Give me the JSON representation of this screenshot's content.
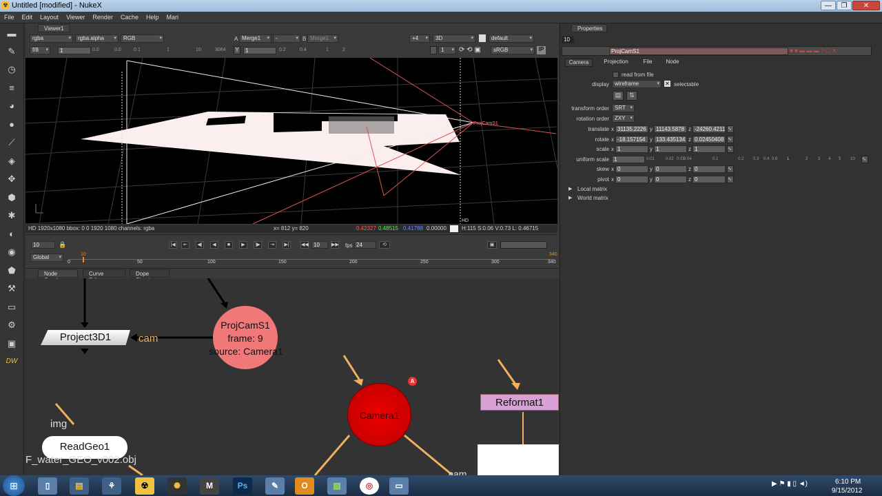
{
  "window": {
    "title": "Untitled [modified] - NukeX",
    "minimize": "—",
    "maximize": "❐",
    "close": "✕"
  },
  "menu": [
    "File",
    "Edit",
    "Layout",
    "Viewer",
    "Render",
    "Cache",
    "Help",
    "Mari"
  ],
  "viewer": {
    "tab": "Viewer1",
    "channels": "rgba",
    "alpha": "rgba.alpha",
    "display_channels": "RGB",
    "a_label": "A",
    "a_input": "Merge1",
    "a_op": "-",
    "b_label": "B",
    "b_input": "Merge1",
    "zoom": "+4",
    "view_mode": "3D",
    "lut": "default",
    "fstop": "f/8",
    "gain": "1",
    "gain_ticks": [
      "0.0",
      "0.0",
      "0.1",
      "1",
      "10",
      "3064"
    ],
    "gamma_label": "Y",
    "gamma": "1",
    "gamma_ticks": [
      "0.2",
      "0.4",
      "1",
      "2"
    ],
    "frame_field": "1",
    "proxy": "1",
    "colorspace": "sRGB",
    "ip": "IP",
    "cam_label": "ProjCamS1",
    "hd_label": "HD",
    "status": {
      "format": "HD 1920x1080 bbox: 0 0 1920 1080 channels: rgba",
      "coords": "x= 812 y= 820",
      "r": "0.42327",
      "g": "0.48515",
      "b": "0.41788",
      "a": "0.00000",
      "hsv": "H:115 S:0.06 V:0.73  L: 0.46715"
    }
  },
  "playback": {
    "frame": "10",
    "step": "10",
    "fps_label": "fps",
    "fps": "24",
    "range_mode": "Global"
  },
  "timeline": {
    "ticks": [
      "0",
      "50",
      "100",
      "150",
      "200",
      "250",
      "300",
      "340"
    ],
    "current": "10",
    "end": "340"
  },
  "tabs": {
    "node_graph": "Node Graph",
    "curve_editor": "Curve Editor",
    "dope_sheet": "Dope Sheet"
  },
  "nodes": {
    "project3d": "Project3D1",
    "cam_label": "cam",
    "projcam_name": "ProjCamS1",
    "projcam_frame": "frame: 9",
    "projcam_source": "source: Camera1",
    "camera": "Camera1",
    "reformat": "Reformat1",
    "readgeo": "ReadGeo1",
    "readgeo_file": "F_water_GEO_v002.obj",
    "img_label": "img",
    "cam_label2": "cam",
    "badge": "A"
  },
  "properties": {
    "tab": "Properties",
    "count": "10",
    "node_name": "ProjCamS1",
    "tabs": [
      "Camera",
      "Projection",
      "File",
      "Node"
    ],
    "read_from_file": "read from file",
    "display_label": "display",
    "display_value": "wireframe",
    "selectable": "selectable",
    "transform_order_label": "transform order",
    "transform_order": "SRT",
    "rotation_order_label": "rotation order",
    "rotation_order": "ZXY",
    "rows": [
      {
        "label": "translate",
        "x": "31135.2226",
        "y": "11143.5878",
        "z": "-24260.4211"
      },
      {
        "label": "rotate",
        "x": "-18.157154",
        "y": "133.435134",
        "z": "0.02450408"
      },
      {
        "label": "scale",
        "x": "1",
        "y": "1",
        "z": "1"
      }
    ],
    "uniform_scale_label": "uniform scale",
    "uniform_scale": "1",
    "uniform_ticks": [
      "0.01",
      "0.02",
      "0.03",
      "0.04",
      "0.1",
      "0.2",
      "0.3",
      "0.4",
      "0.6",
      "1",
      "2",
      "3",
      "4",
      "5",
      "10"
    ],
    "rows2": [
      {
        "label": "skew",
        "x": "0",
        "y": "0",
        "z": "0"
      },
      {
        "label": "pivot",
        "x": "0",
        "y": "0",
        "z": "0"
      }
    ],
    "local_matrix": "Local matrix",
    "world_matrix": "World matrix",
    "axis_x": "x",
    "axis_y": "y",
    "axis_z": "z"
  },
  "taskbar": {
    "time": "6:10 PM",
    "date": "9/15/2012"
  }
}
